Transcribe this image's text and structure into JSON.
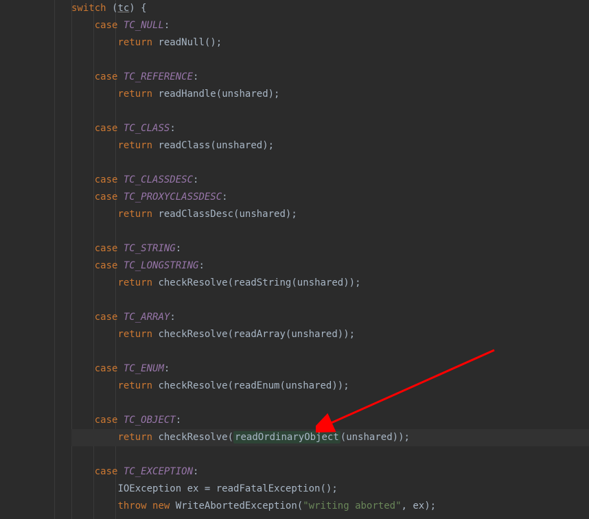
{
  "code": {
    "switch_kw": "switch",
    "switch_var": "tc",
    "case_kw": "case",
    "return_kw": "return",
    "throw_kw": "throw",
    "new_kw": "new",
    "cases": {
      "tc_null": "TC_NULL",
      "tc_reference": "TC_REFERENCE",
      "tc_class": "TC_CLASS",
      "tc_classdesc": "TC_CLASSDESC",
      "tc_proxyclassdesc": "TC_PROXYCLASSDESC",
      "tc_string": "TC_STRING",
      "tc_longstring": "TC_LONGSTRING",
      "tc_array": "TC_ARRAY",
      "tc_enum": "TC_ENUM",
      "tc_object": "TC_OBJECT",
      "tc_exception": "TC_EXCEPTION"
    },
    "methods": {
      "readNull": "readNull",
      "readHandle": "readHandle",
      "readClass": "readClass",
      "readClassDesc": "readClassDesc",
      "checkResolve": "checkResolve",
      "readString": "readString",
      "readArray": "readArray",
      "readEnum": "readEnum",
      "readOrdinaryObject": "readOrdinaryObject",
      "readFatalException": "readFatalException",
      "WriteAbortedException": "WriteAbortedException"
    },
    "params": {
      "unshared": "unshared",
      "ex": "ex"
    },
    "types": {
      "IOException": "IOException"
    },
    "vars": {
      "ex": "ex"
    },
    "strings": {
      "writing_aborted": "\"writing aborted\""
    },
    "punct": {
      "open_brace": " {",
      "open_paren": " (",
      "close_paren_open_brace": ") {",
      "colon": ":",
      "open_p": "(",
      "close_p": ")",
      "close_p_semi": ");",
      "close_pp_semi": "));",
      "semi": ";",
      "eq": " = ",
      "comma_sp": ", "
    }
  }
}
